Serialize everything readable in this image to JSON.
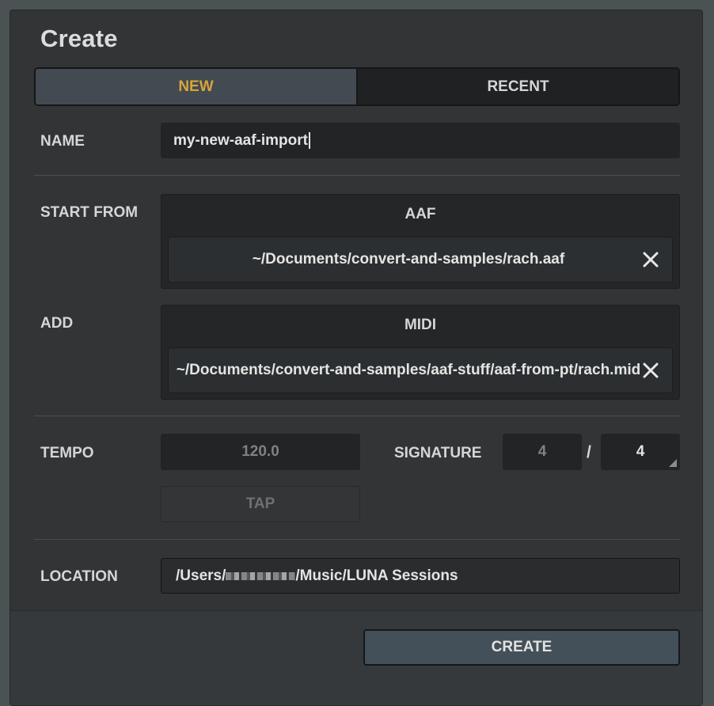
{
  "dialog": {
    "title": "Create",
    "tabs": [
      {
        "label": "NEW",
        "active": true
      },
      {
        "label": "RECENT",
        "active": false
      }
    ],
    "accent_color": "#d8a53a"
  },
  "name": {
    "label": "NAME",
    "value": "my-new-aaf-import"
  },
  "start_from": {
    "label": "START FROM",
    "type": "AAF",
    "path": "~/Documents/convert-and-samples/rach.aaf"
  },
  "add": {
    "label": "ADD",
    "type": "MIDI",
    "path": "~/Documents/convert-and-samples/aaf-stuff/aaf-from-pt/rach.mid"
  },
  "tempo": {
    "label": "TEMPO",
    "value": "120.0",
    "tap_label": "TAP"
  },
  "signature": {
    "label": "SIGNATURE",
    "numerator": "4",
    "separator": "/",
    "denominator": "4"
  },
  "location": {
    "label": "LOCATION",
    "path_prefix": "/Users/",
    "path_suffix": "/Music/LUNA Sessions"
  },
  "actions": {
    "create_label": "CREATE"
  }
}
